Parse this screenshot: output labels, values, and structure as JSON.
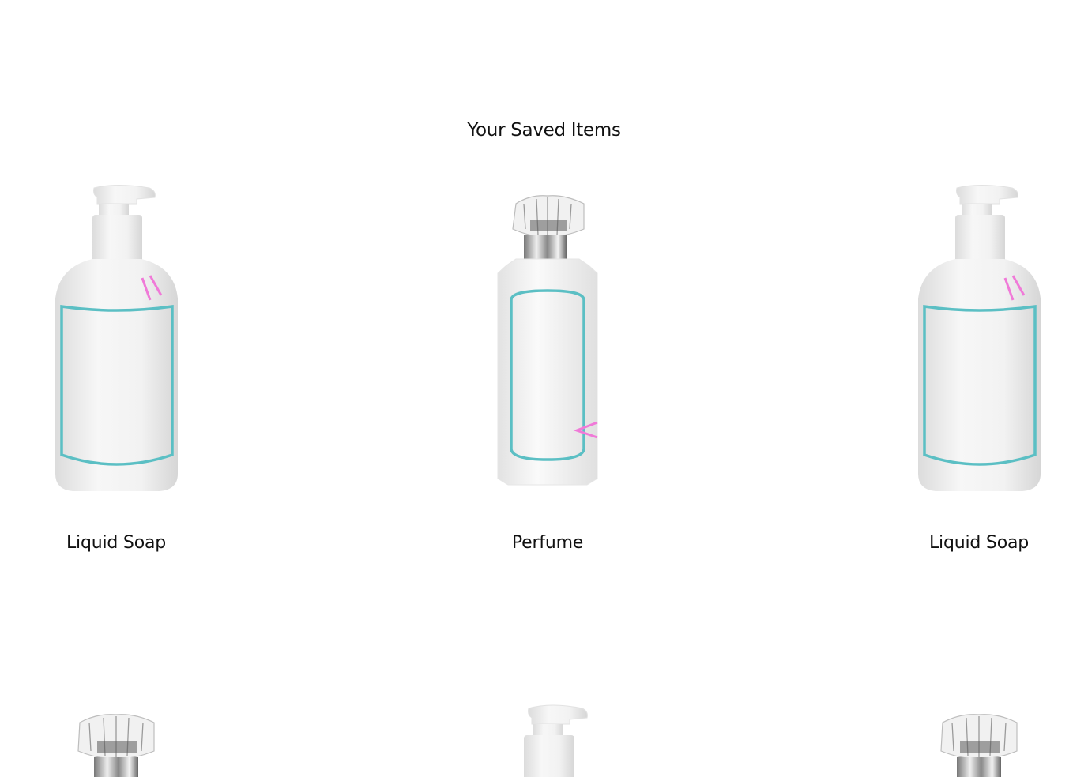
{
  "page": {
    "title": "Your Saved Items"
  },
  "items": [
    {
      "name": "Liquid Soap",
      "image": "liquid-soap-bottle"
    },
    {
      "name": "Perfume",
      "image": "perfume-bottle"
    },
    {
      "name": "Liquid Soap",
      "image": "liquid-soap-bottle"
    },
    {
      "name": "",
      "image": "perfume-bottle"
    },
    {
      "name": "",
      "image": "liquid-soap-bottle"
    },
    {
      "name": "",
      "image": "perfume-bottle"
    }
  ],
  "colors": {
    "label_outline": "#5bbfc4",
    "accent_marks": "#f07ad8",
    "background": "#ffffff"
  }
}
